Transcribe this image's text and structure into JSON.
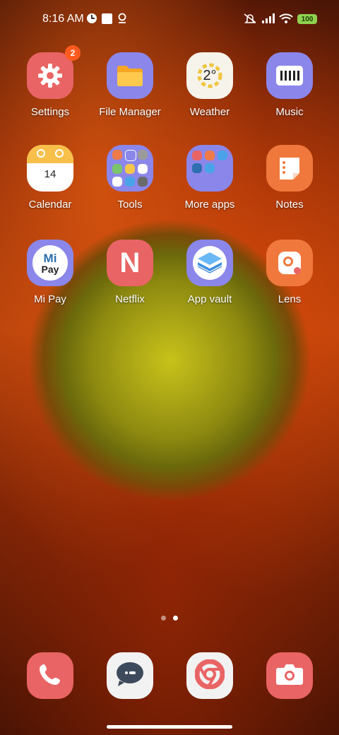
{
  "status_bar": {
    "time": "8:16 AM",
    "battery": "100",
    "icons": [
      "notification-app-icon",
      "square-notification-icon",
      "location-pin-icon",
      "mute-vibrate-icon",
      "signal-icon",
      "wifi-icon",
      "battery-icon"
    ]
  },
  "apps": [
    {
      "label": "Settings",
      "badge": "2",
      "icon": "gear-icon",
      "color": "#e96464"
    },
    {
      "label": "File Manager",
      "icon": "folder-icon",
      "color": "#8b86ea"
    },
    {
      "label": "Weather",
      "icon": "sun-icon",
      "icon_text": "2°",
      "color": "#f6f3ea"
    },
    {
      "label": "Music",
      "icon": "music-icon",
      "color": "#8b86ea"
    },
    {
      "label": "Calendar",
      "icon": "calendar-icon",
      "icon_text": "14",
      "color": "#ffffff"
    },
    {
      "label": "Tools",
      "icon": "folder-group-icon",
      "color": "#8b86ea"
    },
    {
      "label": "More apps",
      "icon": "folder-group-icon",
      "color": "#8b86ea"
    },
    {
      "label": "Notes",
      "icon": "notes-icon",
      "color": "#f0783c"
    },
    {
      "label": "Mi Pay",
      "icon": "mi-pay-icon",
      "icon_text_top": "Mi",
      "icon_text_bottom": "Pay",
      "color": "#8b86ea"
    },
    {
      "label": "Netflix",
      "icon": "netflix-icon",
      "icon_text": "N",
      "color": "#e96464"
    },
    {
      "label": "App vault",
      "icon": "app-vault-icon",
      "color": "#8b86ea"
    },
    {
      "label": "Lens",
      "icon": "lens-icon",
      "color": "#f0783c"
    }
  ],
  "page_indicator": {
    "count": 2,
    "active": 2
  },
  "dock": [
    {
      "name": "phone",
      "icon": "phone-icon",
      "color": "#e96464"
    },
    {
      "name": "messages",
      "icon": "message-icon",
      "color": "#f2f2f2"
    },
    {
      "name": "browser",
      "icon": "browser-icon",
      "color": "#f2f2f2"
    },
    {
      "name": "camera",
      "icon": "camera-icon",
      "color": "#e96464"
    }
  ]
}
